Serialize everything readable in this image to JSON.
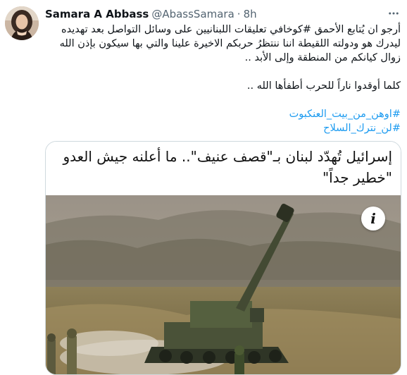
{
  "tweet": {
    "author_name": "Samara A Abbass",
    "author_handle": "@AbassSamara",
    "separator": "·",
    "time": "8h",
    "more_icon": "ellipsis-icon",
    "text_line_1": "أرجو ان يُتابع الأحمق #كوخافي تعليقات اللبنانيين على وسائل التواصل بعد تهديده",
    "text_line_2": "ليدرك هو ودولته اللقيطة اننا ننتظرُ حربكم الاخيرة علينا والتي بها سيكون بإذن الله",
    "text_line_3": "زوال كيانكم من المنطقة وإلى الأبد ..",
    "text_para_2": "كلما أوقدوا ناراً للحرب أطفأها الله ..",
    "hashtags": [
      "#اوهن_من_بيت_العنكبوت",
      "#لن_نترك_السلاح"
    ],
    "hashtag_color": "#1d9bf0"
  },
  "card": {
    "headline_line_1": "إسرائيل تُهدّد لبنان بـ\"قصف عنيف\".. ما أعلنه جيش العدو",
    "headline_line_2": "\"خطير جداً\"",
    "info_badge": "i"
  }
}
